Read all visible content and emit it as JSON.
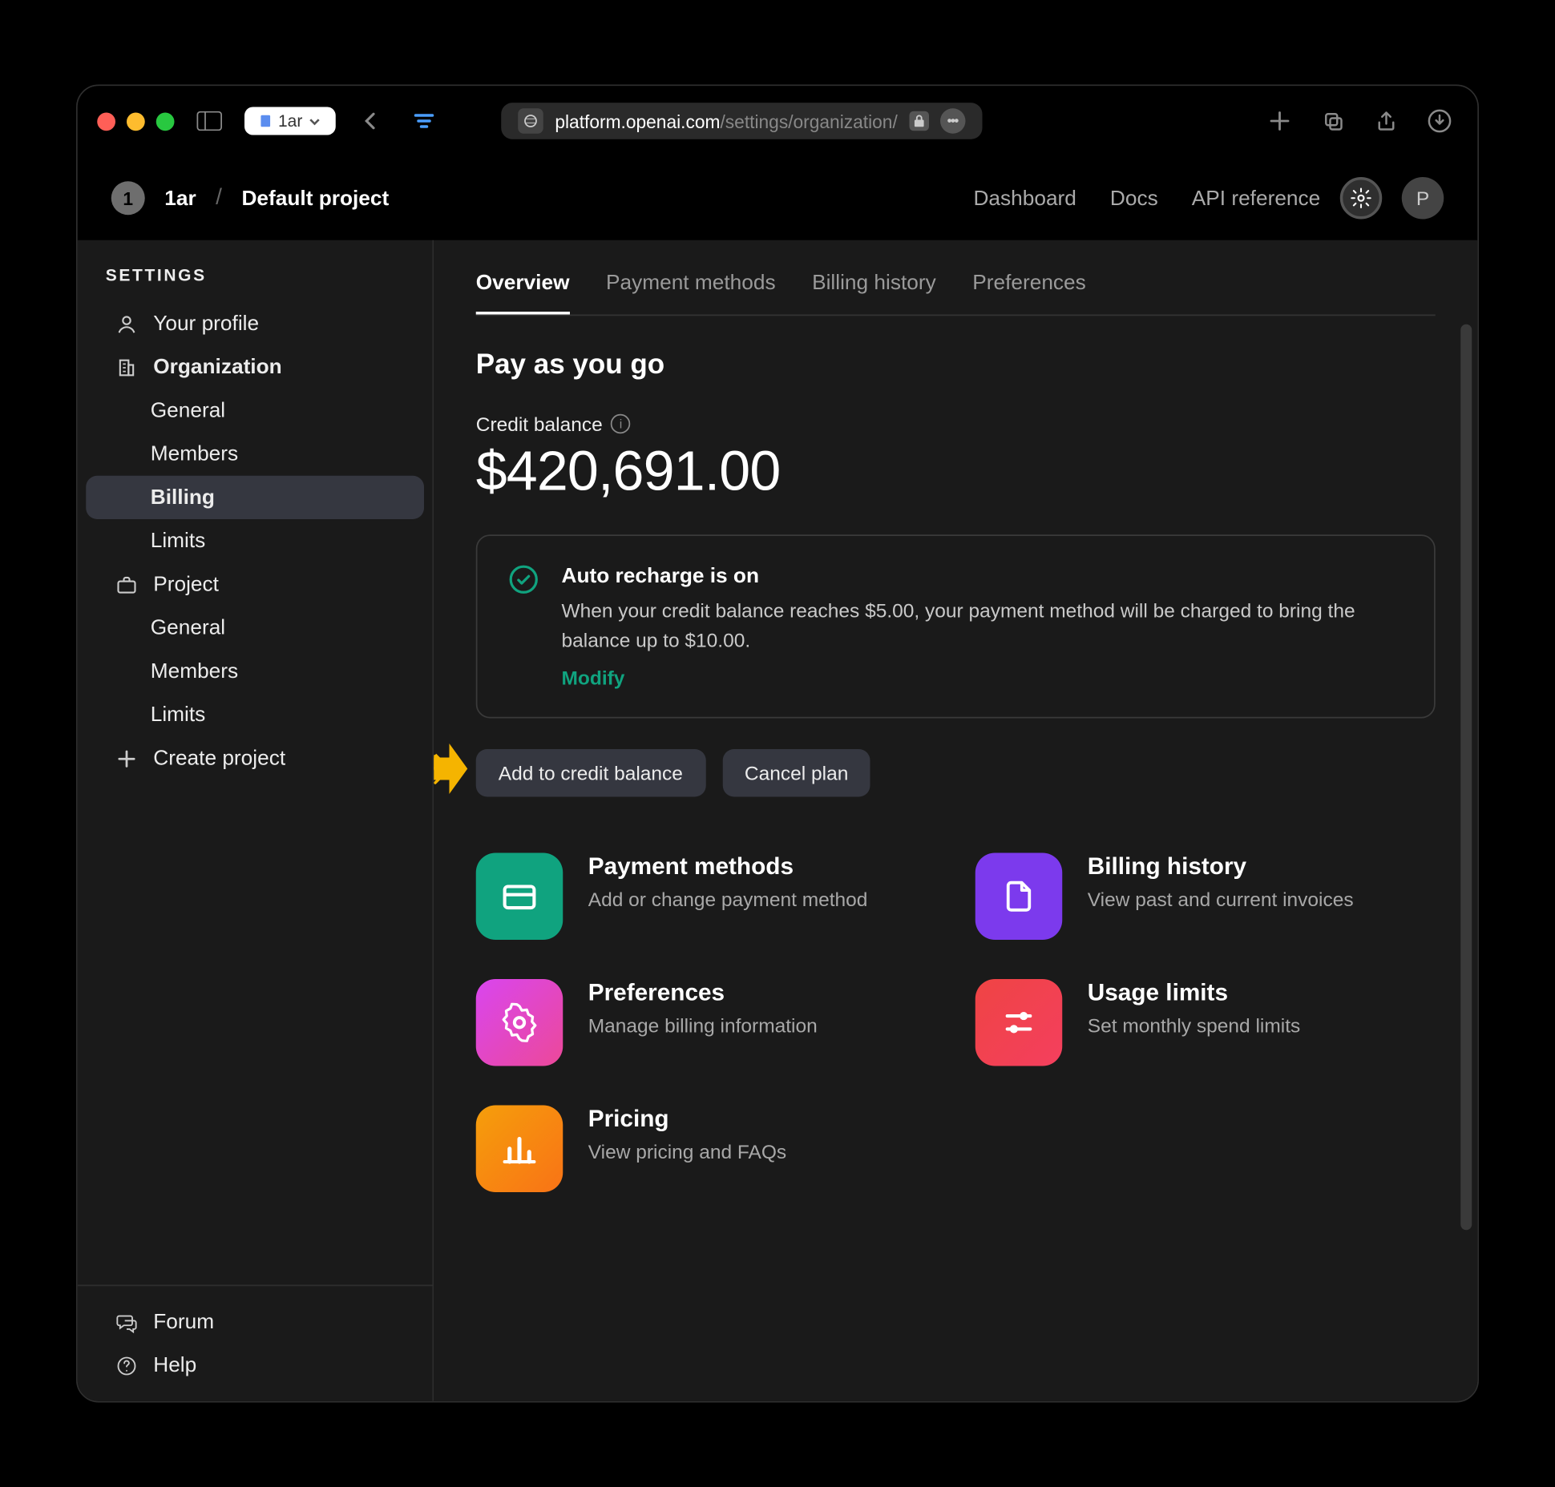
{
  "browser": {
    "pill_label": "1ar",
    "url_domain": "platform.openai.com",
    "url_path": "/settings/organization/"
  },
  "header": {
    "badge": "1",
    "org": "1ar",
    "project": "Default project",
    "links": [
      "Dashboard",
      "Docs",
      "API reference"
    ],
    "avatar": "P"
  },
  "sidebar": {
    "heading": "SETTINGS",
    "items": [
      {
        "label": "Your profile",
        "icon": "user"
      },
      {
        "label": "Organization",
        "icon": "building"
      },
      {
        "label": "General",
        "sub": true
      },
      {
        "label": "Members",
        "sub": true
      },
      {
        "label": "Billing",
        "sub": true,
        "active": true
      },
      {
        "label": "Limits",
        "sub": true
      },
      {
        "label": "Project",
        "icon": "briefcase"
      },
      {
        "label": "General",
        "sub": true
      },
      {
        "label": "Members",
        "sub": true
      },
      {
        "label": "Limits",
        "sub": true
      },
      {
        "label": "Create project",
        "icon": "plus"
      }
    ],
    "footer": [
      {
        "label": "Forum",
        "icon": "chat"
      },
      {
        "label": "Help",
        "icon": "help"
      }
    ]
  },
  "main": {
    "tabs": [
      "Overview",
      "Payment methods",
      "Billing history",
      "Preferences"
    ],
    "active_tab": 0,
    "heading": "Pay as you go",
    "balance_label": "Credit balance",
    "balance_amount": "$420,691.00",
    "recharge": {
      "title": "Auto recharge is on",
      "desc": "When your credit balance reaches $5.00, your payment method will be charged to bring the balance up to $10.00.",
      "modify": "Modify"
    },
    "buttons": {
      "add_credit": "Add to credit balance",
      "cancel_plan": "Cancel plan"
    },
    "cards": [
      {
        "title": "Payment methods",
        "desc": "Add or change payment method",
        "icon": "card",
        "color": "#10a37f"
      },
      {
        "title": "Billing history",
        "desc": "View past and current invoices",
        "icon": "file",
        "color": "#7c3aed"
      },
      {
        "title": "Preferences",
        "desc": "Manage billing information",
        "icon": "gear",
        "color": "#d946ef"
      },
      {
        "title": "Usage limits",
        "desc": "Set monthly spend limits",
        "icon": "sliders",
        "color": "#ef4444"
      },
      {
        "title": "Pricing",
        "desc": "View pricing and FAQs",
        "icon": "chart",
        "color": "#f59e0b"
      }
    ]
  }
}
